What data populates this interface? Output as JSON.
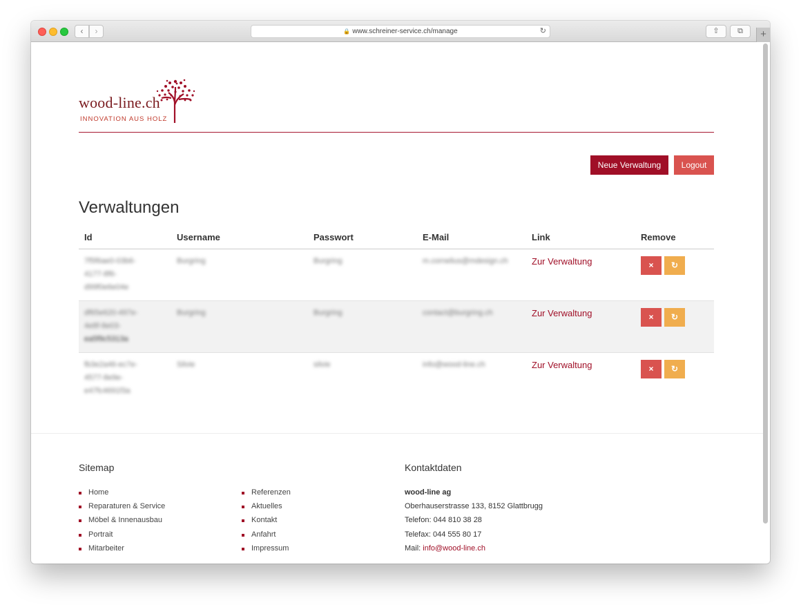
{
  "browser": {
    "url": "www.schreiner-service.ch/manage",
    "back_icon": "‹",
    "forward_icon": "›",
    "reload_icon": "↻",
    "share_icon": "⇧",
    "tabs_icon": "⧉",
    "newtab_icon": "+"
  },
  "logo": {
    "name": "wood-line.ch",
    "tagline": "INNOVATION  AUS HOLZ"
  },
  "actions": {
    "new_label": "Neue Verwaltung",
    "logout_label": "Logout"
  },
  "page": {
    "title": "Verwaltungen"
  },
  "table": {
    "headers": [
      "Id",
      "Username",
      "Passwort",
      "E-Mail",
      "Link",
      "Remove"
    ],
    "rows": [
      {
        "id": [
          "7f5f6ae0-03b6-",
          "4177-8f6-",
          "d99f0e6e04e"
        ],
        "username": "Burgring",
        "password": "Burgring",
        "email": "m.cornelius@mdesign.ch",
        "link": "Zur Verwaltung"
      },
      {
        "id": [
          "df65e620-497e-",
          "4e8f-8e03-",
          "ea5f9c5313a"
        ],
        "username": "Burgring",
        "password": "Burgring",
        "email": "contact@burgring.ch",
        "link": "Zur Verwaltung"
      },
      {
        "id": [
          "fb3e2a46-ec7e-",
          "4577-8e9e-",
          "e47fc4691f3a"
        ],
        "username": "Silvie",
        "password": "silvie",
        "email": "info@wood-line.ch",
        "link": "Zur Verwaltung"
      }
    ],
    "delete_icon": "×",
    "reset_icon": "↻"
  },
  "footer": {
    "sitemap_title": "Sitemap",
    "sitemap_col1": [
      "Home",
      "Reparaturen & Service",
      "Möbel & Innenausbau",
      "Portrait",
      "Mitarbeiter"
    ],
    "sitemap_col2": [
      "Referenzen",
      "Aktuelles",
      "Kontakt",
      "Anfahrt",
      "Impressum"
    ],
    "contact_title": "Kontaktdaten",
    "company": "wood-line ag",
    "address": "Oberhauserstrasse 133, 8152 Glattbrugg",
    "phone": "Telefon: 044 810 38 28",
    "fax": "Telefax: 044 555 80 17",
    "mail_label": "Mail: ",
    "mail": "info@wood-line.ch"
  },
  "colors": {
    "brand": "#a00f27",
    "danger": "#d9534f",
    "warning": "#f0ad4e"
  }
}
